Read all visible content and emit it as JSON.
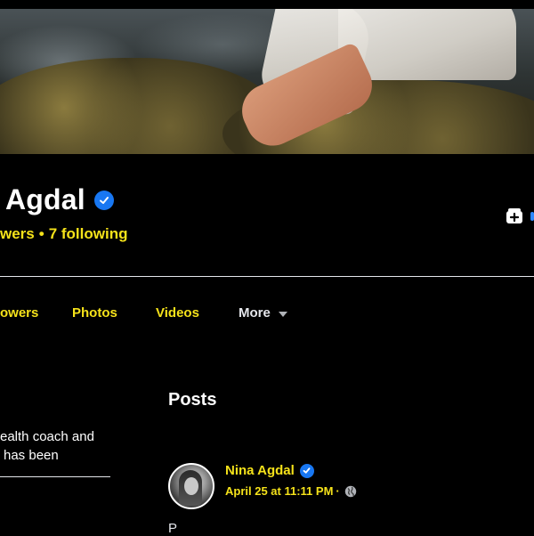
{
  "profile": {
    "name": "Agdal",
    "stats": {
      "followers": "wers",
      "separator": "•",
      "following": "7 following"
    }
  },
  "tabs": [
    {
      "label": "owers"
    },
    {
      "label": "Photos"
    },
    {
      "label": "Videos"
    },
    {
      "label": "More"
    }
  ],
  "intro": {
    "line1": "ealth coach and",
    "line2": "has been"
  },
  "posts": {
    "title": "Posts",
    "first": {
      "author": "Nina Agdal",
      "date": "April 25 at 11:11 PM",
      "separator": "·",
      "text": "P"
    }
  },
  "icons": {
    "verified": "verified-badge-icon",
    "message": "add-friend-icon",
    "globe": "globe-icon",
    "caret": "caret-down-icon"
  },
  "colors": {
    "accent_text": "#f5e21a",
    "verified": "#1877f2",
    "background": "#000000"
  }
}
